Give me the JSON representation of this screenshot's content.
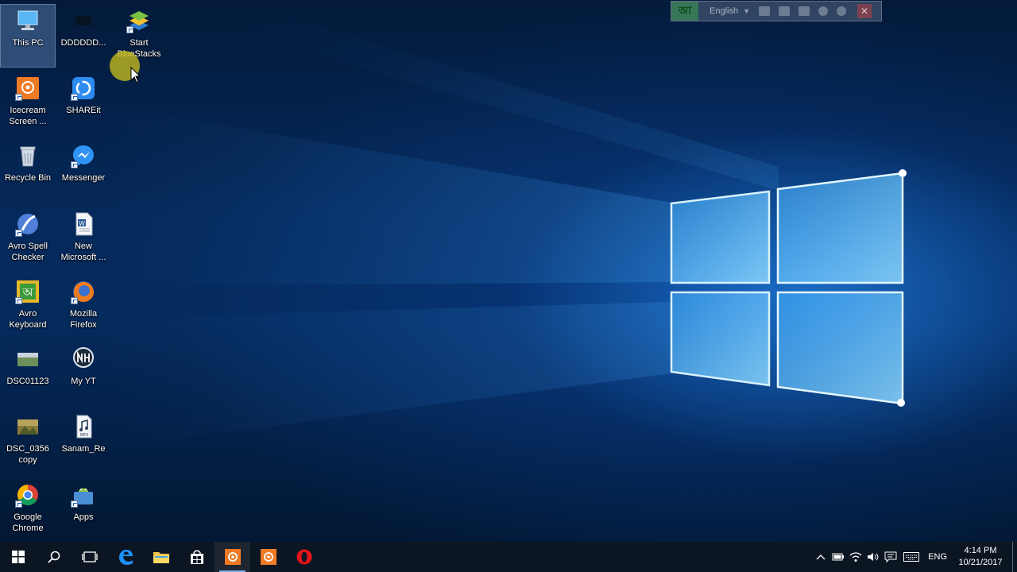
{
  "desktop": {
    "icons": [
      {
        "id": "this-pc",
        "label": "This PC",
        "selected": true
      },
      {
        "id": "dddddd",
        "label": "DDDDDD..."
      },
      {
        "id": "start-bluestacks",
        "label": "Start BlueStacks"
      },
      {
        "id": "icecream",
        "label": "Icecream Screen ..."
      },
      {
        "id": "shareit",
        "label": "SHAREit"
      },
      {
        "id": "recycle-bin",
        "label": "Recycle Bin"
      },
      {
        "id": "messenger",
        "label": "Messenger"
      },
      {
        "id": "avro-spell",
        "label": "Avro Spell Checker"
      },
      {
        "id": "new-microsoft",
        "label": "New Microsoft ..."
      },
      {
        "id": "avro-keyboard",
        "label": "Avro Keyboard"
      },
      {
        "id": "mozilla-firefox",
        "label": "Mozilla Firefox"
      },
      {
        "id": "dsc01123",
        "label": "DSC01123"
      },
      {
        "id": "my-yt",
        "label": "My YT"
      },
      {
        "id": "dsc0356",
        "label": "DSC_0356 copy"
      },
      {
        "id": "sanam-re",
        "label": "Sanam_Re"
      },
      {
        "id": "google-chrome",
        "label": "Google Chrome"
      },
      {
        "id": "apps",
        "label": "Apps"
      }
    ]
  },
  "language_bar": {
    "icon_text": "আ",
    "language": "English"
  },
  "taskbar": {
    "pinned": [
      "start",
      "search",
      "task-view",
      "edge",
      "file-explorer",
      "store",
      "icecream-1",
      "icecream-2",
      "opera"
    ],
    "active_item": "icecream-1"
  },
  "tray": {
    "language": "ENG",
    "time": "4:14 PM",
    "date": "10/21/2017"
  },
  "colors": {
    "taskbar_bg": "#0c1622",
    "accent": "#78a9e8",
    "wallpaper_glow": "#2d9cff"
  }
}
